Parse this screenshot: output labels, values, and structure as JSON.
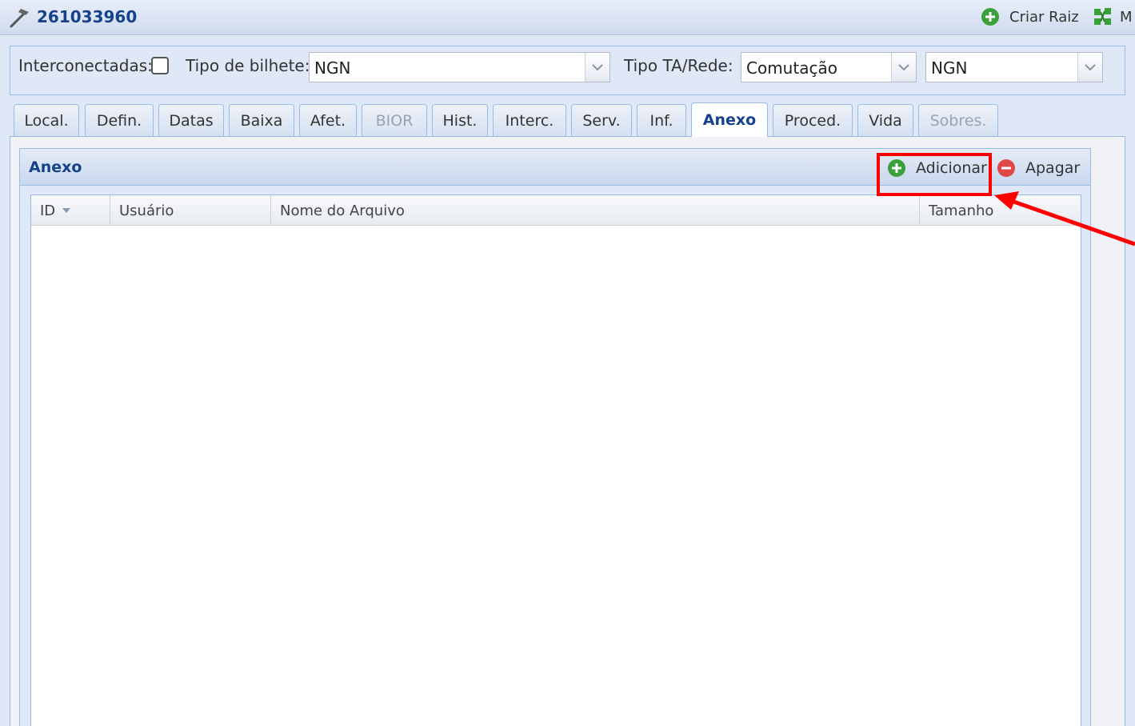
{
  "header": {
    "title": "261033960",
    "title_icon": "hammer-icon",
    "criar_raiz_label": "Criar Raiz",
    "extra_button_label": "M"
  },
  "filters": {
    "interconectadas_label": "Interconectadas:",
    "interconectadas_checked": false,
    "tipo_bilhete_label": "Tipo de bilhete:",
    "tipo_bilhete_value": "NGN",
    "tipo_ta_rede_label": "Tipo TA/Rede:",
    "tipo_ta_rede_value": "Comutação",
    "rede_value": "NGN"
  },
  "tabs": [
    {
      "label": "Local."
    },
    {
      "label": "Defin."
    },
    {
      "label": "Datas"
    },
    {
      "label": "Baixa"
    },
    {
      "label": "Afet."
    },
    {
      "label": "BIOR",
      "disabled": true
    },
    {
      "label": "Hist."
    },
    {
      "label": "Interc."
    },
    {
      "label": "Serv."
    },
    {
      "label": "Inf."
    },
    {
      "label": "Anexo",
      "active": true
    },
    {
      "label": "Proced."
    },
    {
      "label": "Vida"
    },
    {
      "label": "Sobres.",
      "disabled": true
    }
  ],
  "panel": {
    "title": "Anexo",
    "add_label": "Adicionar",
    "delete_label": "Apagar",
    "columns": [
      "ID",
      "Usuário",
      "Nome do Arquivo",
      "Tamanho"
    ],
    "rows": []
  },
  "colors": {
    "header_text": "#15428b",
    "panel_border": "#99bbe8",
    "add_icon": "#3aa13a",
    "delete_icon": "#e04848",
    "annotation": "#ff0000"
  }
}
